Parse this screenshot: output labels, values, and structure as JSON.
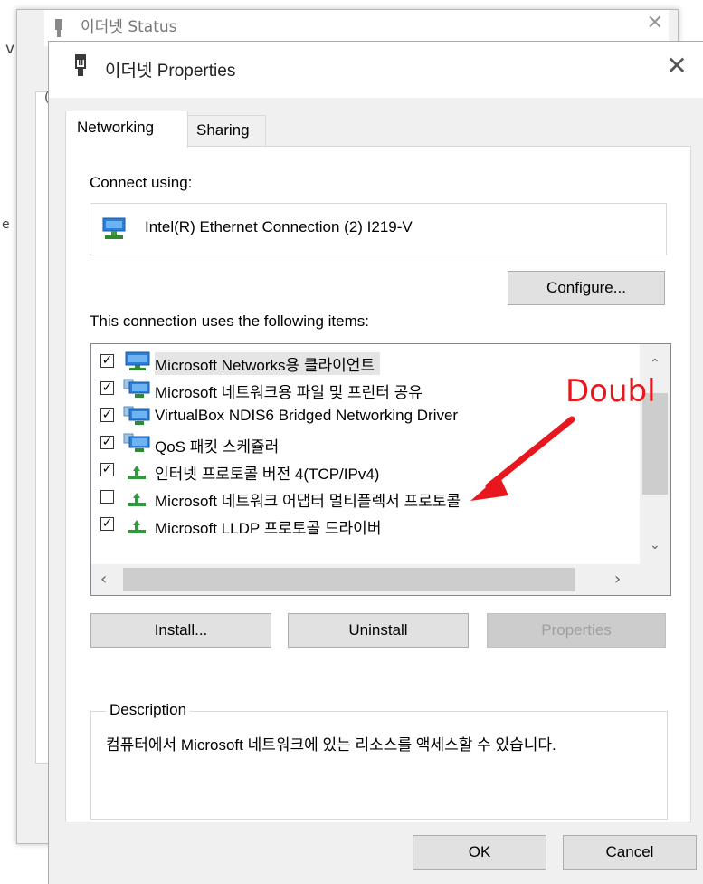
{
  "background_window": {
    "title": "이더넷 Status",
    "edge_chars": [
      "v",
      "(",
      "e"
    ]
  },
  "dialog": {
    "title": "이더넷 Properties",
    "close_symbol": "✕",
    "tabs": [
      {
        "label": "Networking",
        "active": true
      },
      {
        "label": "Sharing",
        "active": false
      }
    ],
    "connect_using_label": "Connect using:",
    "adapter_name": "Intel(R) Ethernet Connection (2) I219-V",
    "configure_button": "Configure...",
    "items_label": "This connection uses the following items:",
    "items": [
      {
        "checked": true,
        "label": "Microsoft Networks용 클라이언트",
        "icon": "network-client-icon",
        "selected": true
      },
      {
        "checked": true,
        "label": "Microsoft 네트워크용 파일 및 프린터 공유",
        "icon": "network-service-icon",
        "selected": false
      },
      {
        "checked": true,
        "label": "VirtualBox NDIS6 Bridged Networking Driver",
        "icon": "network-service-icon",
        "selected": false
      },
      {
        "checked": true,
        "label": "QoS 패킷 스케쥴러",
        "icon": "network-service-icon",
        "selected": false
      },
      {
        "checked": true,
        "label": "인터넷 프로토콜 버전 4(TCP/IPv4)",
        "icon": "protocol-icon",
        "selected": false
      },
      {
        "checked": false,
        "label": "Microsoft 네트워크 어댑터 멀티플렉서 프로토콜",
        "icon": "protocol-icon",
        "selected": false
      },
      {
        "checked": true,
        "label": "Microsoft LLDP 프로토콜 드라이버",
        "icon": "protocol-icon",
        "selected": false
      }
    ],
    "install_button": "Install...",
    "uninstall_button": "Uninstall",
    "properties_button": "Properties",
    "description_legend": "Description",
    "description_text": "컴퓨터에서 Microsoft 네트워크에 있는 리소스를 액세스할 수 있습니다.",
    "ok_button": "OK",
    "cancel_button": "Cancel"
  },
  "annotation": {
    "text": "Doubl",
    "color": "#e8171e"
  },
  "colors": {
    "dialog_bg": "#f0f0f0",
    "panel_bg": "#ffffff",
    "disabled_text": "#a0a0a0"
  }
}
